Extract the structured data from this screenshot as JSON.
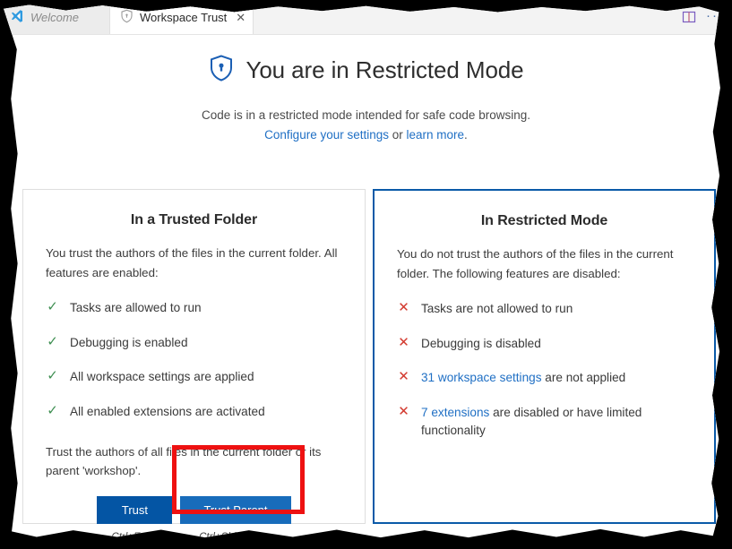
{
  "window": {
    "tabs": [
      {
        "label": "Welcome",
        "icon": "vscode-logo-icon",
        "active": false,
        "preview": true
      },
      {
        "label": "Workspace Trust",
        "icon": "shield-icon",
        "active": true,
        "preview": false,
        "close": "✕"
      }
    ],
    "actions": [
      {
        "name": "split-editor-icon",
        "label": ""
      },
      {
        "name": "more-actions-icon",
        "label": "···"
      }
    ]
  },
  "header": {
    "title": "You are in Restricted Mode",
    "title_icon": "shield-lock-icon",
    "subtitle_line1": "Code is in a restricted mode intended for safe code browsing.",
    "subtitle_link1": "Configure your settings",
    "subtitle_or": " or ",
    "subtitle_link2": "learn more",
    "subtitle_period": "."
  },
  "trusted_panel": {
    "title": "In a Trusted Folder",
    "description": "You trust the authors of the files in the current folder. All features are enabled:",
    "features": [
      {
        "mark": "✓",
        "text": "Tasks are allowed to run"
      },
      {
        "mark": "✓",
        "text": "Debugging is enabled"
      },
      {
        "mark": "✓",
        "text": "All workspace settings are applied"
      },
      {
        "mark": "✓",
        "text": "All enabled extensions are activated"
      }
    ],
    "trust_note": "Trust the authors of all files in the current folder or its parent 'workshop'.",
    "buttons": [
      {
        "label": "Trust",
        "shortcut": "Ctrl+Enter",
        "state": "default"
      },
      {
        "label": "Trust Parent",
        "shortcut": "Ctrl+Shift+Enter",
        "state": "hover"
      }
    ]
  },
  "restricted_panel": {
    "title": "In Restricted Mode",
    "description": "You do not trust the authors of the files in the current folder. The following features are disabled:",
    "features": [
      {
        "mark": "✕",
        "text": "Tasks are not allowed to run",
        "link": ""
      },
      {
        "mark": "✕",
        "text": "Debugging is disabled",
        "link": ""
      },
      {
        "mark": "✕",
        "link": "31 workspace settings",
        "text": " are not applied"
      },
      {
        "mark": "✕",
        "link": "7 extensions",
        "text": " are disabled or have limited functionality"
      }
    ]
  },
  "colors": {
    "accent_blue": "#0455a4",
    "hover_blue": "#186cbb",
    "link_blue": "#1f6fc4",
    "check_green": "#3f8f52",
    "cross_red": "#d33b30",
    "annotation_red": "#ee1111",
    "panel_border_active": "#0a5aa8"
  }
}
